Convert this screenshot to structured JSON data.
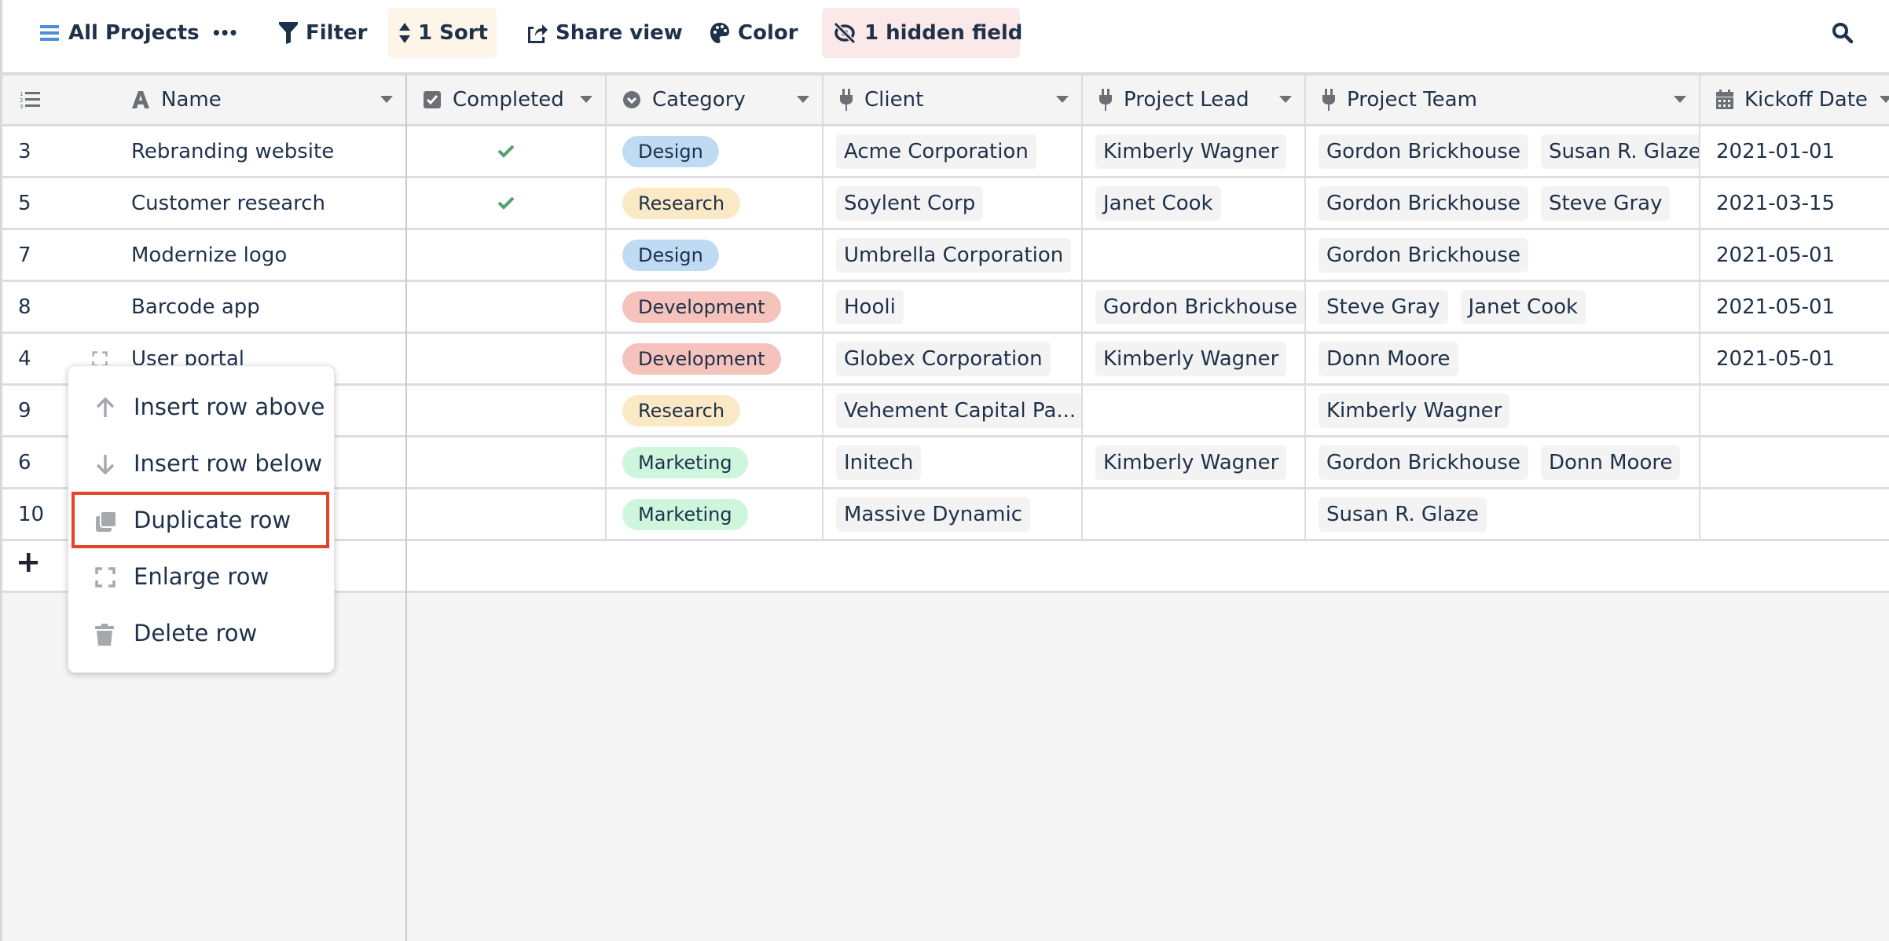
{
  "toolbar": {
    "view_name": "All Projects",
    "more_label": "•••",
    "filter_label": "Filter",
    "sort_label": "1 Sort",
    "share_label": "Share view",
    "color_label": "Color",
    "hidden_label": "1 hidden field",
    "icons": {
      "view": "hamburger-icon",
      "more": "more-dots-icon",
      "filter": "filter-icon",
      "sort": "sort-icon",
      "share": "share-icon",
      "color": "palette-icon",
      "hidden": "eye-slash-icon",
      "search": "search-icon"
    },
    "colors": {
      "sort_bg": "#fdf5e8",
      "hidden_bg": "#fbe8e8",
      "accent": "#4a90d9"
    }
  },
  "columns": [
    {
      "key": "rownum",
      "label": "",
      "icon": "row-number-icon"
    },
    {
      "key": "name",
      "label": "Name",
      "icon": "text-icon"
    },
    {
      "key": "completed",
      "label": "Completed",
      "icon": "checkbox-icon"
    },
    {
      "key": "category",
      "label": "Category",
      "icon": "select-icon"
    },
    {
      "key": "client",
      "label": "Client",
      "icon": "link-plug-icon"
    },
    {
      "key": "project_lead",
      "label": "Project Lead",
      "icon": "link-plug-icon"
    },
    {
      "key": "project_team",
      "label": "Project Team",
      "icon": "link-plug-icon"
    },
    {
      "key": "kickoff_date",
      "label": "Kickoff Date",
      "icon": "calendar-icon"
    }
  ],
  "category_colors": {
    "Design": "#bfdbf3",
    "Research": "#fbe9c6",
    "Development": "#f5c3bc",
    "Marketing": "#cdf6dd"
  },
  "rows": [
    {
      "id": "3",
      "name": "Rebranding website",
      "completed": true,
      "category": "Design",
      "client": "Acme Corporation",
      "project_lead": [
        "Kimberly Wagner"
      ],
      "project_team": [
        "Gordon Brickhouse",
        "Susan R. Glaze"
      ],
      "kickoff_date": "2021-01-01"
    },
    {
      "id": "5",
      "name": "Customer research",
      "completed": true,
      "category": "Research",
      "client": "Soylent Corp",
      "project_lead": [
        "Janet Cook"
      ],
      "project_team": [
        "Gordon Brickhouse",
        "Steve Gray"
      ],
      "kickoff_date": "2021-03-15"
    },
    {
      "id": "7",
      "name": "Modernize logo",
      "completed": false,
      "category": "Design",
      "client": "Umbrella Corporation",
      "project_lead": [],
      "project_team": [
        "Gordon Brickhouse"
      ],
      "kickoff_date": "2021-05-01"
    },
    {
      "id": "8",
      "name": "Barcode app",
      "completed": false,
      "category": "Development",
      "client": "Hooli",
      "project_lead": [
        "Gordon Brickhouse"
      ],
      "project_team": [
        "Steve Gray",
        "Janet Cook"
      ],
      "kickoff_date": "2021-05-01"
    },
    {
      "id": "4",
      "name": "User portal",
      "completed": false,
      "category": "Development",
      "client": "Globex Corporation",
      "project_lead": [
        "Kimberly Wagner"
      ],
      "project_team": [
        "Donn Moore"
      ],
      "kickoff_date": "2021-05-01"
    },
    {
      "id": "9",
      "name": "",
      "completed": false,
      "category": "Research",
      "client": "Vehement Capital Pa...",
      "project_lead": [],
      "project_team": [
        "Kimberly Wagner"
      ],
      "kickoff_date": ""
    },
    {
      "id": "6",
      "name": "",
      "completed": false,
      "category": "Marketing",
      "client": "Initech",
      "project_lead": [
        "Kimberly Wagner"
      ],
      "project_team": [
        "Gordon Brickhouse",
        "Donn Moore"
      ],
      "kickoff_date": ""
    },
    {
      "id": "10",
      "name": "",
      "completed": false,
      "category": "Marketing",
      "client": "Massive Dynamic",
      "project_lead": [],
      "project_team": [
        "Susan R. Glaze"
      ],
      "kickoff_date": ""
    }
  ],
  "add_row_label": "+",
  "context_menu": {
    "items": [
      {
        "label": "Insert row above",
        "icon": "arrow-up-icon"
      },
      {
        "label": "Insert row below",
        "icon": "arrow-down-icon"
      },
      {
        "label": "Duplicate row",
        "icon": "copy-icon",
        "highlighted": true
      },
      {
        "label": "Enlarge row",
        "icon": "expand-icon"
      },
      {
        "label": "Delete row",
        "icon": "trash-icon"
      }
    ],
    "highlight_color": "#e6432b"
  }
}
